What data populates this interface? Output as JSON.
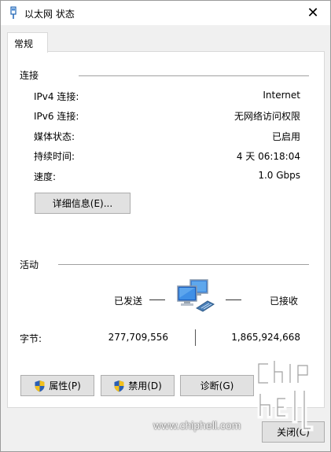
{
  "window": {
    "title": "以太网 状态",
    "close_glyph": "✕"
  },
  "tab": {
    "label": "常规"
  },
  "connection": {
    "section_title": "连接",
    "rows": [
      {
        "label": "IPv4 连接:",
        "value": "Internet"
      },
      {
        "label": "IPv6 连接:",
        "value": "无网络访问权限"
      },
      {
        "label": "媒体状态:",
        "value": "已启用"
      },
      {
        "label": "持续时间:",
        "value": "4 天 06:18:04"
      },
      {
        "label": "速度:",
        "value": "1.0 Gbps"
      }
    ],
    "details_button": "详细信息(E)..."
  },
  "activity": {
    "section_title": "活动",
    "sent_label": "已发送",
    "received_label": "已接收",
    "bytes_label": "字节:",
    "bytes_sent": "277,709,556",
    "bytes_received": "1,865,924,668",
    "icon": "network-computers-icon"
  },
  "buttons": {
    "properties": "属性(P)",
    "disable": "禁用(D)",
    "diagnose": "诊断(G)",
    "close": "关闭(C)"
  },
  "watermark": {
    "url": "www.chiphell.com",
    "logo": "chiphell-logo"
  },
  "colors": {
    "accent": "#0078d7",
    "shield_blue": "#2b5fb4",
    "shield_yellow": "#f2c01e"
  }
}
